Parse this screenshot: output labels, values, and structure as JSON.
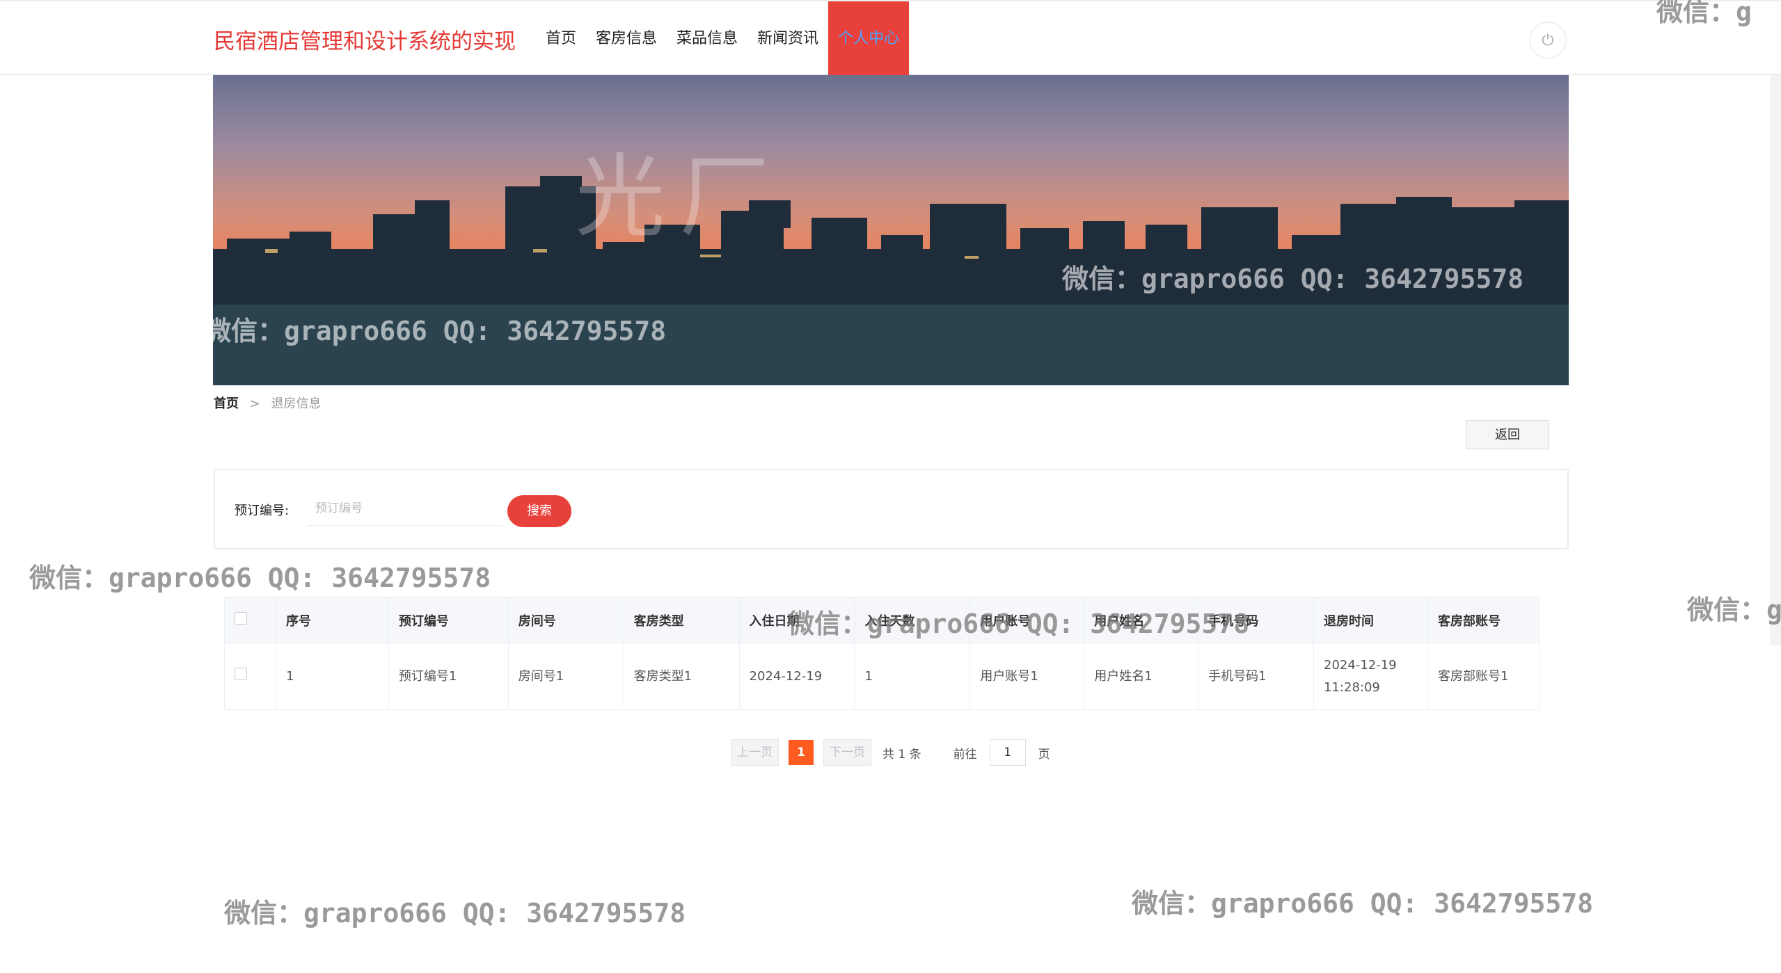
{
  "header": {
    "site_title": "民宿酒店管理和设计系统的实现",
    "nav": [
      "首页",
      "客房信息",
      "菜品信息",
      "新闻资讯",
      "个人中心"
    ],
    "active_nav": "个人中心"
  },
  "banner": {
    "logo_text": "光厂"
  },
  "breadcrumb": {
    "home": "首页",
    "separator": ">",
    "current": "退房信息"
  },
  "back_button": "返回",
  "search": {
    "label": "预订编号:",
    "placeholder": "预订编号",
    "value": "",
    "button": "搜索"
  },
  "table": {
    "columns": [
      "序号",
      "预订编号",
      "房间号",
      "客房类型",
      "入住日期",
      "入住天数",
      "用户账号",
      "用户姓名",
      "手机号码",
      "退房时间",
      "客房部账号"
    ],
    "rows": [
      [
        "1",
        "预订编号1",
        "房间号1",
        "客房类型1",
        "2024-12-19",
        "1",
        "用户账号1",
        "用户姓名1",
        "手机号码1",
        "2024-12-19 11:28:09",
        "客房部账号1"
      ]
    ]
  },
  "pagination": {
    "prev": "上一页",
    "current_page": "1",
    "next": "下一页",
    "total": "共 1 条",
    "goto_label": "前往",
    "goto_value": "1",
    "page_suffix": "页"
  },
  "watermark": "微信：grapro666 QQ: 3642795578",
  "watermark_cut": "微信：g",
  "colors": {
    "accent": "#e8403a",
    "title": "#e53935",
    "active_link": "#4aa3ff",
    "page_active": "#ff5a1f"
  }
}
